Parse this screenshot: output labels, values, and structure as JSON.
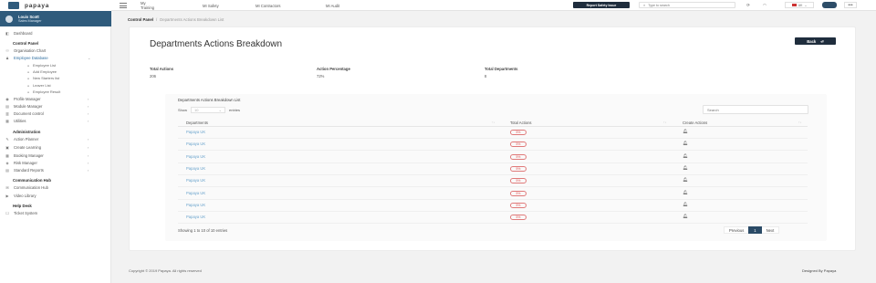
{
  "brand": {
    "name": "papaya"
  },
  "topnav": {
    "items": [
      "My Training",
      "MI Safety",
      "MI Contractors",
      "MI Audit"
    ],
    "report_button": "Report Safety Issue",
    "search_placeholder": "Type to search",
    "language": "UK",
    "more": "•••"
  },
  "user": {
    "name": "Louis Scott",
    "role": "Sales Manager"
  },
  "sidebar": {
    "items": [
      {
        "label": "Dashboard",
        "type": "link",
        "icon": "dashboard-icon",
        "glyph": "◧"
      },
      {
        "label": "Control Panel",
        "type": "head"
      },
      {
        "label": "Organisation Chart",
        "type": "link",
        "icon": "org-chart-icon",
        "glyph": "⚇"
      },
      {
        "label": "Employee Database",
        "type": "link",
        "icon": "users-icon",
        "glyph": "♟",
        "chevron": "⌄",
        "active": true
      },
      {
        "label": "Employee List",
        "type": "sub",
        "glyph": "●"
      },
      {
        "label": "Add Employee",
        "type": "sub",
        "glyph": "●"
      },
      {
        "label": "New Starters list",
        "type": "sub",
        "glyph": "●"
      },
      {
        "label": "Leaver List",
        "type": "sub",
        "glyph": "●"
      },
      {
        "label": "Employee Result",
        "type": "sub",
        "glyph": "●"
      },
      {
        "label": "Profile Manager",
        "type": "link",
        "icon": "profile-icon",
        "glyph": "◉",
        "chevron": "›"
      },
      {
        "label": "Module Manager",
        "type": "link",
        "icon": "module-icon",
        "glyph": "▤",
        "chevron": "›"
      },
      {
        "label": "Document control",
        "type": "link",
        "icon": "document-icon",
        "glyph": "▥",
        "chevron": "›"
      },
      {
        "label": "Utilities",
        "type": "link",
        "icon": "utilities-icon",
        "glyph": "▦",
        "chevron": "›"
      },
      {
        "label": "Administration",
        "type": "head"
      },
      {
        "label": "Action Planner",
        "type": "link",
        "icon": "planner-icon",
        "glyph": "✎",
        "chevron": "›"
      },
      {
        "label": "Create Learning",
        "type": "link",
        "icon": "learning-icon",
        "glyph": "▣",
        "chevron": "›"
      },
      {
        "label": "Booking Manager",
        "type": "link",
        "icon": "booking-icon",
        "glyph": "▦",
        "chevron": "›"
      },
      {
        "label": "Risk Manager",
        "type": "link",
        "icon": "risk-icon",
        "glyph": "◈",
        "chevron": "›"
      },
      {
        "label": "Standard Reports",
        "type": "link",
        "icon": "reports-icon",
        "glyph": "▤",
        "chevron": "›"
      },
      {
        "label": "Communication Hub",
        "type": "head"
      },
      {
        "label": "Communication Hub",
        "type": "link",
        "icon": "chat-icon",
        "glyph": "✉"
      },
      {
        "label": "Video Library",
        "type": "link",
        "icon": "video-icon",
        "glyph": "▶"
      },
      {
        "label": "Help Desk",
        "type": "head"
      },
      {
        "label": "Ticket System",
        "type": "link",
        "icon": "ticket-icon",
        "glyph": "☐"
      }
    ]
  },
  "breadcrumb": {
    "root": "Control Panel",
    "separator": "/",
    "current": "Departments Actions Breakdown List"
  },
  "page": {
    "title": "Departments Actions Breakdown",
    "back_label": "Back",
    "stats": [
      {
        "label": "Total Actions",
        "value": "206"
      },
      {
        "label": "Action Percentage",
        "value": "72%"
      },
      {
        "label": "Total Departments",
        "value": "8"
      }
    ]
  },
  "table": {
    "title": "Departments Actions Breakdown List",
    "show_label": "Show",
    "entries_value": "10",
    "entries_label": "entries",
    "search_placeholder": "Search",
    "columns": [
      "Departments",
      "Total Actions",
      "Create Actions"
    ],
    "rows": [
      {
        "department": "Papaya UK",
        "total": "5%"
      },
      {
        "department": "Papaya UK",
        "total": "5%"
      },
      {
        "department": "Papaya UK",
        "total": "5%"
      },
      {
        "department": "Papaya UK",
        "total": "5%"
      },
      {
        "department": "Papaya UK",
        "total": "5%"
      },
      {
        "department": "Papaya UK",
        "total": "5%"
      },
      {
        "department": "Papaya UK",
        "total": "5%"
      },
      {
        "department": "Papaya UK",
        "total": "5%"
      }
    ],
    "info": "Showing 1 to 10 of 10 entries",
    "pager": {
      "previous": "Previous",
      "page": "1",
      "next": "Next"
    }
  },
  "footer": {
    "copyright": "Copyright © 2019 Papaya. All rights reserved",
    "designed": "Designed By Papaya"
  }
}
